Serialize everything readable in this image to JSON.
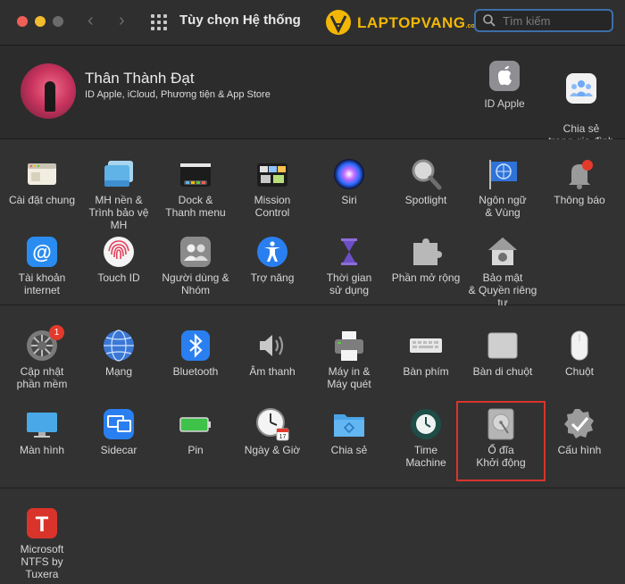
{
  "window": {
    "title": "Tùy chọn Hệ thống",
    "back_glyph": "‹",
    "forward_glyph": "›"
  },
  "watermark": {
    "text": "LAPTOPVANG",
    "suffix": ".com"
  },
  "search": {
    "placeholder": "Tìm kiếm"
  },
  "account": {
    "name": "Thân Thành Đạt",
    "subtitle": "ID Apple, iCloud, Phương tiện & App Store",
    "items": [
      {
        "label": "ID Apple",
        "icon": "apple-id-icon"
      },
      {
        "label": "Chia sẻ\ntrong gia đình",
        "icon": "family-sharing-icon"
      }
    ]
  },
  "section1": {
    "row1": [
      {
        "label": "Cài đặt chung",
        "icon": "general-icon"
      },
      {
        "label": "MH nền &\nTrình bảo vệ MH",
        "icon": "desktop-screensaver-icon"
      },
      {
        "label": "Dock &\nThanh menu",
        "icon": "dock-icon"
      },
      {
        "label": "Mission\nControl",
        "icon": "mission-control-icon"
      },
      {
        "label": "Siri",
        "icon": "siri-icon"
      },
      {
        "label": "Spotlight",
        "icon": "spotlight-icon"
      },
      {
        "label": "Ngôn ngữ\n& Vùng",
        "icon": "language-region-icon"
      },
      {
        "label": "Thông báo",
        "icon": "notifications-icon"
      }
    ],
    "row2": [
      {
        "label": "Tài khoản\ninternet",
        "icon": "internet-accounts-icon"
      },
      {
        "label": "Touch ID",
        "icon": "touch-id-icon"
      },
      {
        "label": "Người dùng &\nNhóm",
        "icon": "users-groups-icon"
      },
      {
        "label": "Trợ năng",
        "icon": "accessibility-icon"
      },
      {
        "label": "Thời gian\nsử dụng",
        "icon": "screen-time-icon"
      },
      {
        "label": "Phần mở rộng",
        "icon": "extensions-icon"
      },
      {
        "label": "Bảo mật\n& Quyền riêng tư",
        "icon": "security-privacy-icon"
      }
    ]
  },
  "section2": {
    "row1": [
      {
        "label": "Cập nhật\nphần mềm",
        "icon": "software-update-icon",
        "badge": "1"
      },
      {
        "label": "Mạng",
        "icon": "network-icon"
      },
      {
        "label": "Bluetooth",
        "icon": "bluetooth-icon"
      },
      {
        "label": "Âm thanh",
        "icon": "sound-icon"
      },
      {
        "label": "Máy in &\nMáy quét",
        "icon": "printers-scanners-icon"
      },
      {
        "label": "Bàn phím",
        "icon": "keyboard-icon"
      },
      {
        "label": "Bàn di chuột",
        "icon": "trackpad-icon"
      },
      {
        "label": "Chuột",
        "icon": "mouse-icon"
      }
    ],
    "row2": [
      {
        "label": "Màn hình",
        "icon": "displays-icon"
      },
      {
        "label": "Sidecar",
        "icon": "sidecar-icon"
      },
      {
        "label": "Pin",
        "icon": "battery-icon"
      },
      {
        "label": "Ngày & Giờ",
        "icon": "date-time-icon",
        "calendar_day": "17"
      },
      {
        "label": "Chia sẻ",
        "icon": "sharing-icon"
      },
      {
        "label": "Time\nMachine",
        "icon": "time-machine-icon"
      },
      {
        "label": "Ổ đĩa\nKhởi động",
        "icon": "startup-disk-icon"
      },
      {
        "label": "Cấu hình",
        "icon": "profiles-icon"
      }
    ]
  },
  "section3": {
    "items": [
      {
        "label": "Microsoft\nNTFS by Tuxera",
        "icon": "tuxera-ntfs-icon",
        "glyph": "T"
      }
    ]
  },
  "colors": {
    "highlight_border": "#d9342b",
    "watermark": "#f2b705",
    "search_focus": "#3c6fa8"
  }
}
